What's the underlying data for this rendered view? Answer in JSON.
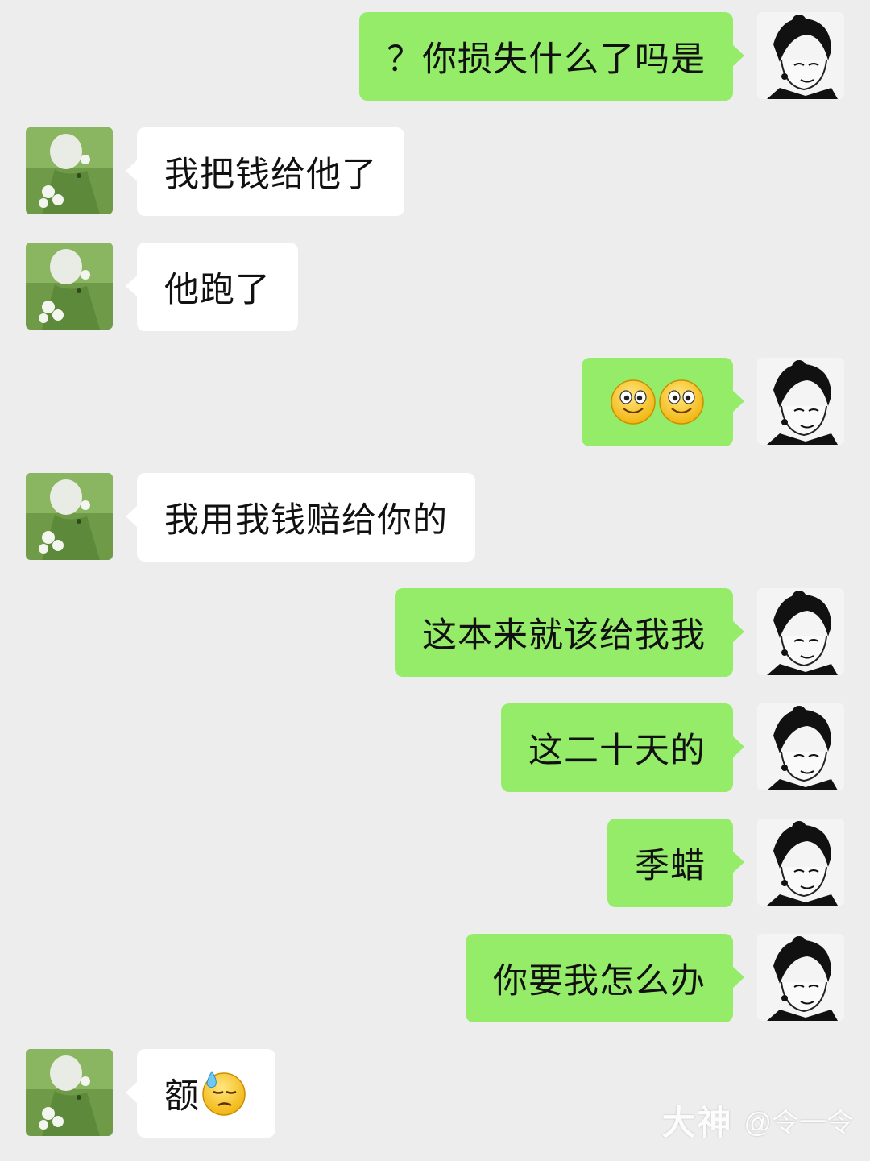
{
  "colors": {
    "background": "#ededed",
    "outgoing_bubble": "#95ec69",
    "incoming_bubble": "#ffffff"
  },
  "messages": [
    {
      "side": "out",
      "text": "？你损失什么了吗是"
    },
    {
      "side": "in",
      "text": "我把钱给他了"
    },
    {
      "side": "in",
      "text": "他跑了"
    },
    {
      "side": "out",
      "emoji": [
        "smile-emoji",
        "smile-emoji"
      ]
    },
    {
      "side": "in",
      "text": "我用我钱赔给你的"
    },
    {
      "side": "out",
      "text": "这本来就该给我我"
    },
    {
      "side": "out",
      "text": "这二十天的"
    },
    {
      "side": "out",
      "text": "季蜡"
    },
    {
      "side": "out",
      "text": "你要我怎么办"
    },
    {
      "side": "in",
      "text": "额",
      "emoji": [
        "cold-sweat-emoji"
      ]
    }
  ],
  "watermark": {
    "brand": "大神",
    "user": "@令一令"
  }
}
